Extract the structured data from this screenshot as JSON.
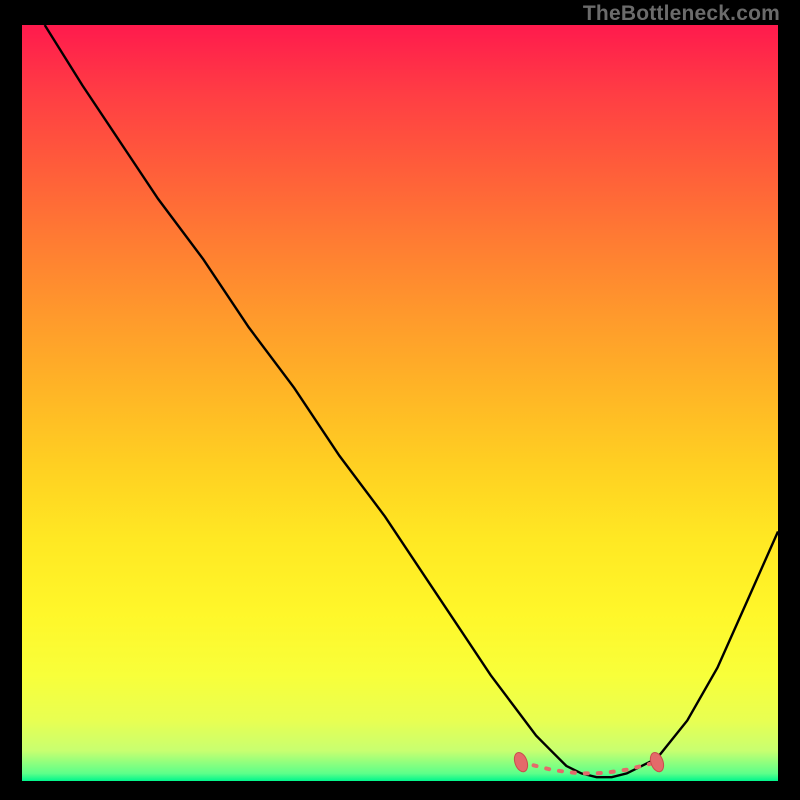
{
  "watermark": {
    "text": "TheBottleneck.com"
  },
  "colors": {
    "line": "#000000",
    "marker_fill": "#e46a6a",
    "marker_stroke": "#c94d4d",
    "gradient_top": "#ff1a4d",
    "gradient_bottom": "#00f58c"
  },
  "chart_data": {
    "type": "line",
    "title": "",
    "xlabel": "",
    "ylabel": "",
    "xlim": [
      0,
      100
    ],
    "ylim": [
      0,
      100
    ],
    "grid": false,
    "series": [
      {
        "name": "curve",
        "x": [
          3,
          8,
          12,
          18,
          24,
          30,
          36,
          42,
          48,
          54,
          58,
          62,
          65,
          68,
          70,
          72,
          74,
          76,
          78,
          80,
          84,
          88,
          92,
          96,
          100
        ],
        "y": [
          100,
          92,
          86,
          77,
          69,
          60,
          52,
          43,
          35,
          26,
          20,
          14,
          10,
          6,
          4,
          2,
          1,
          0.5,
          0.5,
          1,
          3,
          8,
          15,
          24,
          33
        ]
      }
    ],
    "markers": {
      "name": "highlight-range",
      "x": [
        66,
        68,
        70,
        72,
        74,
        76,
        78,
        80,
        82,
        84
      ],
      "y": [
        2.5,
        2,
        1.5,
        1.2,
        1,
        1,
        1.2,
        1.5,
        2,
        2.5
      ]
    }
  }
}
